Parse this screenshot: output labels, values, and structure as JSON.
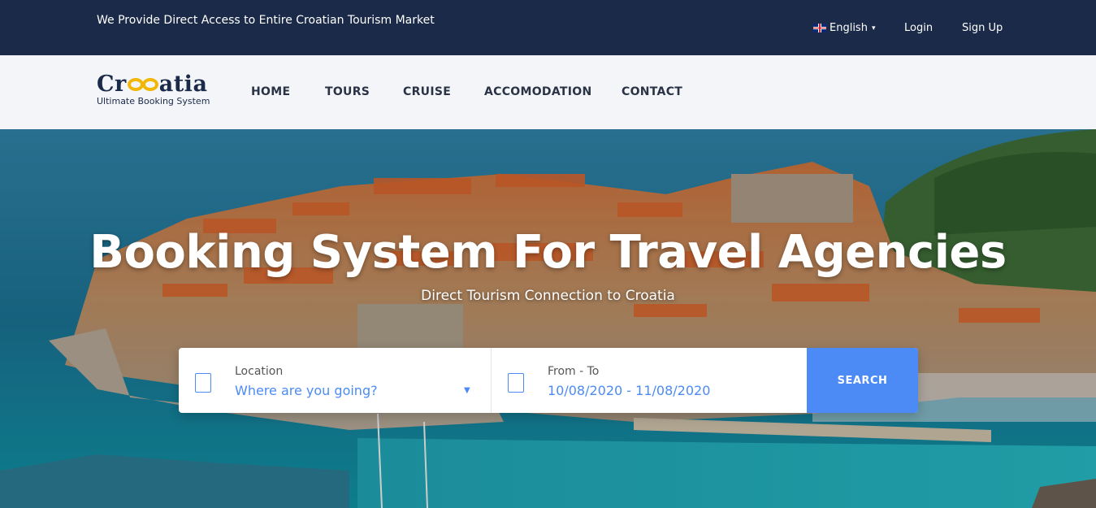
{
  "topbar": {
    "tagline": "We Provide Direct Access to Entire Croatian Tourism Market",
    "language": "English",
    "login": "Login",
    "signup": "Sign Up"
  },
  "brand": {
    "name_prefix": "Cr",
    "name_suffix": "atia",
    "tagline": "Ultimate Booking System",
    "accent_color": "#f2b705",
    "primary_color": "#1b2a48"
  },
  "nav": {
    "items": [
      "HOME",
      "TOURS",
      "CRUISE",
      "ACCOMODATION",
      "CONTACT"
    ]
  },
  "hero": {
    "title": "Booking System For Travel Agencies",
    "subtitle": "Direct Tourism Connection to Croatia"
  },
  "search": {
    "location_label": "Location",
    "location_value": "Where are you going?",
    "date_label": "From - To",
    "date_value": "10/08/2020 - 11/08/2020",
    "button_label": "SEARCH",
    "button_color": "#4c8bf5"
  },
  "icons": {
    "language_flag": "uk-flag-icon",
    "language_caret": "chevron-down-icon",
    "location_dropdown": "triangle-down-icon",
    "location_checkbox": "checkbox-icon",
    "date_checkbox": "checkbox-icon"
  }
}
